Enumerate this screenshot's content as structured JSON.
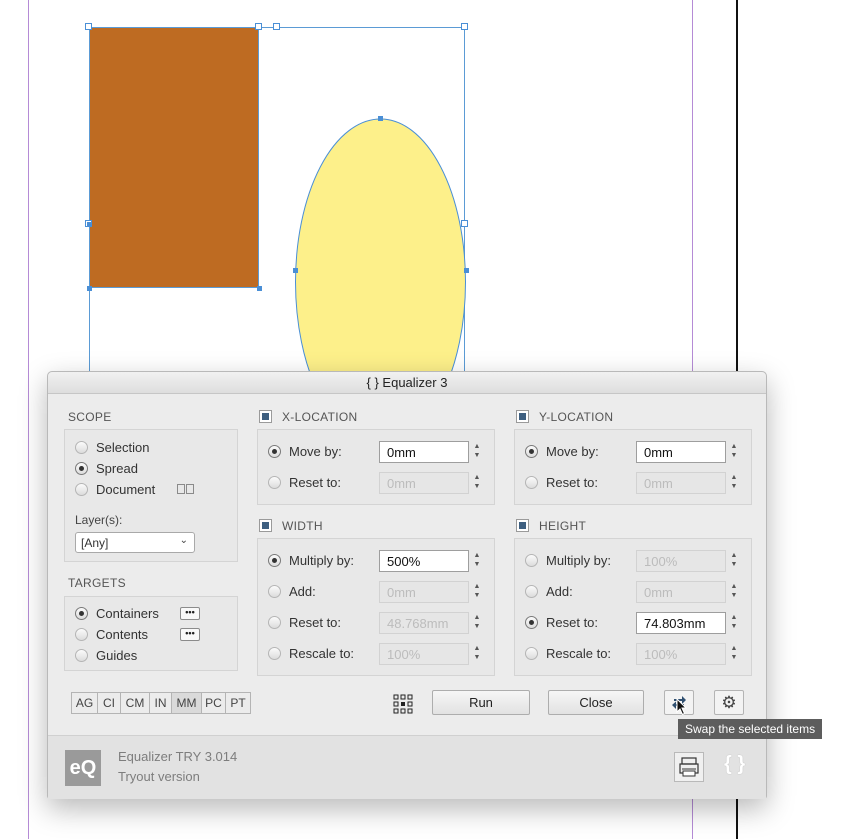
{
  "dialog": {
    "title": "{ }  Equalizer 3",
    "scope": {
      "title": "SCOPE",
      "options": [
        {
          "label": "Selection",
          "selected": false
        },
        {
          "label": "Spread",
          "selected": true
        },
        {
          "label": "Document",
          "selected": false
        }
      ],
      "layers_label": "Layer(s):",
      "layers_value": "[Any]"
    },
    "targets": {
      "title": "TARGETS",
      "options": [
        {
          "label": "Containers",
          "selected": true
        },
        {
          "label": "Contents",
          "selected": false
        },
        {
          "label": "Guides",
          "selected": false
        }
      ],
      "more_label": "•••"
    },
    "x_location": {
      "title": "X-LOCATION",
      "move_label": "Move by:",
      "move_value": "0mm",
      "reset_label": "Reset to:",
      "reset_value": "0mm"
    },
    "y_location": {
      "title": "Y-LOCATION",
      "move_label": "Move by:",
      "move_value": "0mm",
      "reset_label": "Reset to:",
      "reset_value": "0mm"
    },
    "width": {
      "title": "WIDTH",
      "multiply_label": "Multiply by:",
      "multiply_value": "500%",
      "add_label": "Add:",
      "add_value": "0mm",
      "reset_label": "Reset to:",
      "reset_value": "48.768mm",
      "rescale_label": "Rescale to:",
      "rescale_value": "100%"
    },
    "height": {
      "title": "HEIGHT",
      "multiply_label": "Multiply by:",
      "multiply_value": "100%",
      "add_label": "Add:",
      "add_value": "0mm",
      "reset_label": "Reset to:",
      "reset_value": "74.803mm",
      "rescale_label": "Rescale to:",
      "rescale_value": "100%"
    },
    "units": [
      "AG",
      "CI",
      "CM",
      "IN",
      "MM",
      "PC",
      "PT"
    ],
    "active_unit": "MM",
    "run_label": "Run",
    "close_label": "Close",
    "footer": {
      "logo": "eQ",
      "product": "Equalizer TRY  3.014",
      "edition": "Tryout version",
      "brand_glyph": "{ }"
    }
  },
  "tooltip": "Swap the selected items",
  "colors": {
    "rectangle_fill": "#be6b22",
    "ellipse_fill": "#fdf08a",
    "selection": "#4a8fd6",
    "margin_guide": "#b58bd6"
  }
}
